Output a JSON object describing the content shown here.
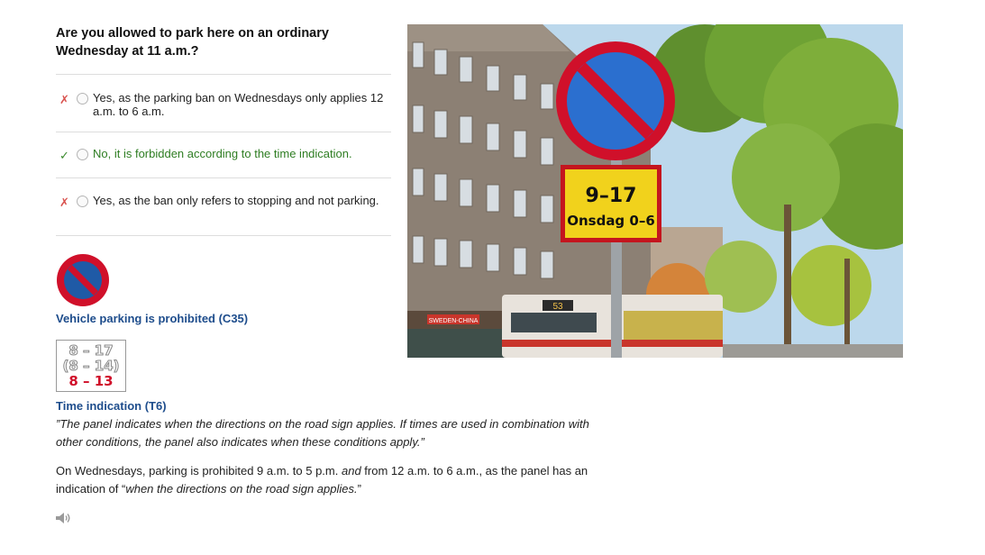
{
  "question": "Are you allowed to park here on an ordinary Wednesday at 11 a.m.?",
  "answers": [
    {
      "mark": "✗",
      "state": "wrong",
      "text": "Yes, as the parking ban on Wednesdays only applies 12 a.m. to 6 a.m."
    },
    {
      "mark": "✓",
      "state": "correct",
      "text": "No, it is forbidden according to the time indication."
    },
    {
      "mark": "✗",
      "state": "wrong",
      "text": "Yes, as the ban only refers to stopping and not parking."
    }
  ],
  "signs": [
    {
      "title": "Vehicle parking is prohibited (C35)"
    },
    {
      "title": "Time indication (T6)",
      "panel_lines": [
        "8 – 17",
        "(8 – 14)",
        "8 – 13"
      ]
    }
  ],
  "quote": "”The panel indicates when the directions on the road sign applies. If times are used in combination with other conditions, the panel also indicates when these conditions apply.”",
  "explanation": {
    "part1": "On Wednesdays, parking is prohibited 9 a.m. to 5 p.m. ",
    "part2": "and",
    "part3": " from 12 a.m. to 6 a.m., as the panel has an indication of “",
    "part4": "when the directions on the road sign applies.",
    "part5": "”"
  },
  "photo": {
    "panel_line1": "9–17",
    "panel_line2": "Onsdag 0–6",
    "shop_sign": "SWEDEN-CHINA",
    "bus_number": "53"
  },
  "icons": {
    "speaker": "speaker-icon"
  },
  "colors": {
    "wrong": "#d9534f",
    "correct": "#2e7d22",
    "sign_title": "#1e4d8c",
    "sign_red": "#d0102a",
    "sign_blue": "#1f5aa6"
  }
}
